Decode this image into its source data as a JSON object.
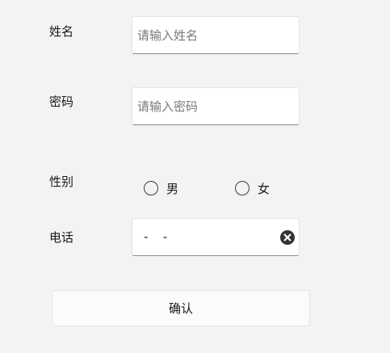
{
  "form": {
    "name": {
      "label": "姓名",
      "value": "",
      "placeholder": "请输入姓名"
    },
    "password": {
      "label": "密码",
      "value": "",
      "placeholder": "请输入密码"
    },
    "gender": {
      "label": "性别",
      "options": [
        {
          "label": "男",
          "selected": false
        },
        {
          "label": "女",
          "selected": false
        }
      ]
    },
    "phone": {
      "label": "电话",
      "value": "-   -",
      "clear_icon": "clear-circle-x-icon"
    },
    "confirm_label": "确认"
  }
}
